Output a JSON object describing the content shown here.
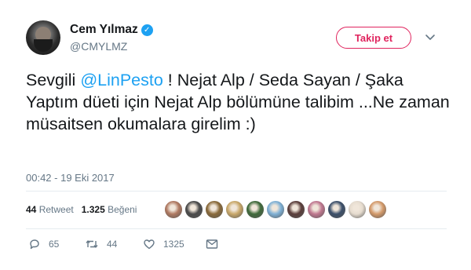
{
  "user": {
    "display_name": "Cem Yılmaz",
    "handle": "@CMYLMZ",
    "verified_glyph": "✓"
  },
  "follow_button_label": "Takip et",
  "tweet": {
    "text_before_mention": "Sevgili ",
    "mention": "@LinPesto",
    "text_after_mention": " ! Nejat Alp / Seda Sayan / Şaka Yaptım düeti için Nejat Alp bölümüne talibim ...Ne zaman müsaitsen okumalara girelim :)",
    "timestamp": "00:42 - 19 Eki 2017"
  },
  "stats": {
    "retweets_count": "44",
    "retweets_label": "Retweet",
    "likes_count": "1.325",
    "likes_label": "Beğeni"
  },
  "likers": [
    {
      "color": "#b07a62"
    },
    {
      "color": "#4a4a4a"
    },
    {
      "color": "#8a6a3a"
    },
    {
      "color": "#c9a86a"
    },
    {
      "color": "#3f6a3a"
    },
    {
      "color": "#7fb1d6"
    },
    {
      "color": "#5a3d3a"
    },
    {
      "color": "#c07890"
    },
    {
      "color": "#3b4f6a"
    },
    {
      "color": "#e6dccf"
    },
    {
      "color": "#d49a6a"
    }
  ],
  "actions": {
    "reply_count": "65",
    "retweet_count": "44",
    "like_count": "1325"
  },
  "colors": {
    "accent": "#1da1f2",
    "follow": "#e0245e",
    "secondary_text": "#657786"
  }
}
